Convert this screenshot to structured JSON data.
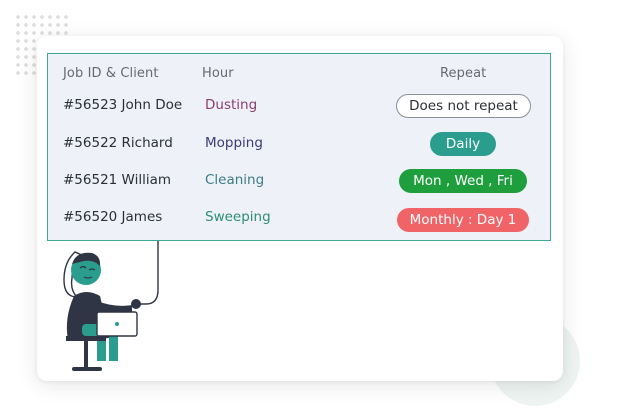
{
  "table": {
    "headers": {
      "job": "Job ID & Client",
      "hour": "Hour",
      "repeat": "Repeat"
    },
    "rows": [
      {
        "job": "#56523 John Doe",
        "task": "Dusting",
        "task_color": "#8a3f6f",
        "repeat": "Does not repeat",
        "repeat_style": "outline"
      },
      {
        "job": "#56522 Richard",
        "task": "Mopping",
        "task_color": "#3b3a78",
        "repeat": "Daily",
        "repeat_style": "teal"
      },
      {
        "job": "#56521 William",
        "task": "Cleaning",
        "task_color": "#3d7c83",
        "repeat": "Mon , Wed , Fri",
        "repeat_style": "green"
      },
      {
        "job": "#56520 James",
        "task": "Sweeping",
        "task_color": "#2d8c78",
        "repeat": "Monthly : Day 1",
        "repeat_style": "red"
      }
    ]
  },
  "colors": {
    "border": "#3ea79a",
    "panel_bg": "#eef2f8",
    "pill_teal": "#2a9d8f",
    "pill_green": "#1e9e3c",
    "pill_red": "#f06366",
    "illustration_teal": "#2a9d8f",
    "illustration_dark": "#2f3545"
  },
  "icons": {
    "dots_pattern": "dot-grid-decoration",
    "person": "person-with-laptop-illustration"
  }
}
